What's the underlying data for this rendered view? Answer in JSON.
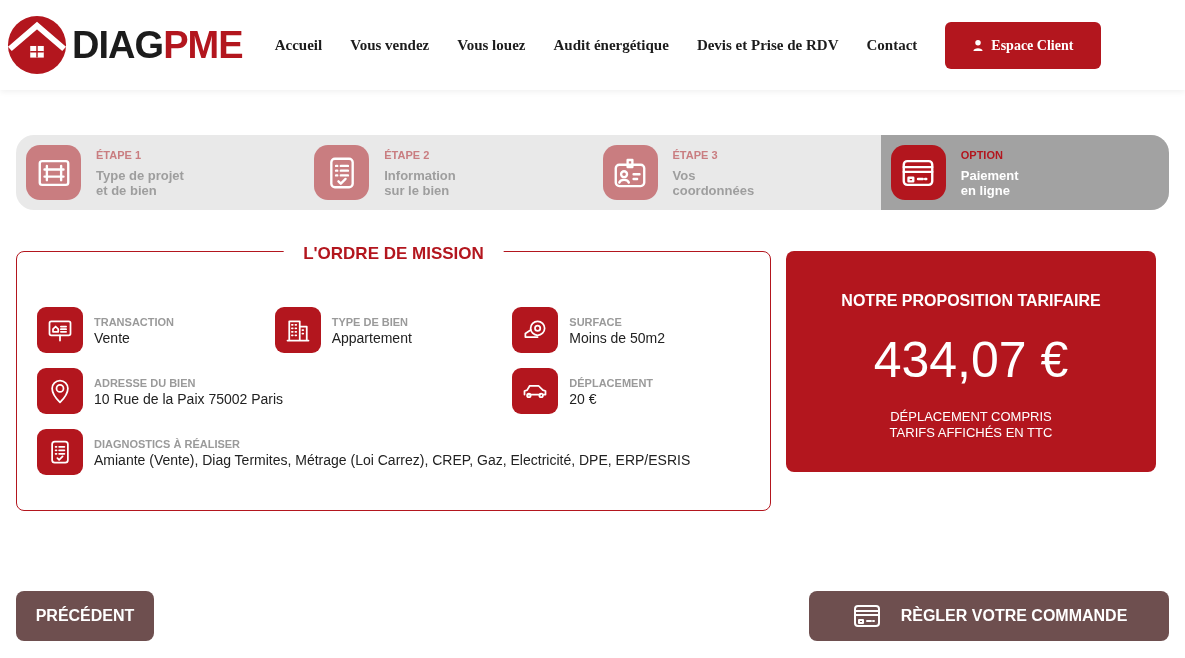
{
  "logo": {
    "part_1": "DIAG",
    "part_2": "PME"
  },
  "nav": [
    {
      "label": "Accueil"
    },
    {
      "label": "Vous vendez"
    },
    {
      "label": "Vous louez"
    },
    {
      "label": "Audit énergétique"
    },
    {
      "label": "Devis et Prise de RDV"
    },
    {
      "label": "Contact"
    }
  ],
  "client_button": "Espace Client",
  "steps": [
    {
      "step": "ÉTAPE 1",
      "line_1": "Type de projet",
      "line_2": "et de bien",
      "selected": false
    },
    {
      "step": "ÉTAPE 2",
      "line_1": "Information",
      "line_2": "sur le bien",
      "selected": false
    },
    {
      "step": "ÉTAPE 3",
      "line_1": "Vos",
      "line_2": "coordonnées",
      "selected": false
    },
    {
      "step": "OPTION",
      "line_1": "Paiement",
      "line_2": "en ligne",
      "selected": true
    }
  ],
  "mission": {
    "title": "L'ORDRE DE MISSION",
    "items": [
      {
        "label": "TRANSACTION",
        "value": "Vente"
      },
      {
        "label": "TYPE DE BIEN",
        "value": "Appartement"
      },
      {
        "label": "SURFACE",
        "value": "Moins de 50m2"
      },
      {
        "label": "ADRESSE DU BIEN",
        "value": "10 Rue de la Paix 75002 Paris"
      },
      {
        "label": "DÉPLACEMENT",
        "value": "20 €"
      },
      {
        "label": "DIAGNOSTICS À RÉALISER",
        "value": "Amiante (Vente), Diag Termites, Métrage (Loi Carrez), CREP, Gaz, Electricité, DPE, ERP/ESRIS"
      }
    ]
  },
  "price": {
    "title": "NOTRE PROPOSITION TARIFAIRE",
    "amount": "434,07 €",
    "note_1": "DÉPLACEMENT COMPRIS",
    "note_2": "TARIFS AFFICHÉS EN TTC"
  },
  "buttons": {
    "back": "PRÉCÉDENT",
    "pay": "RÈGLER VOTRE COMMANDE"
  }
}
